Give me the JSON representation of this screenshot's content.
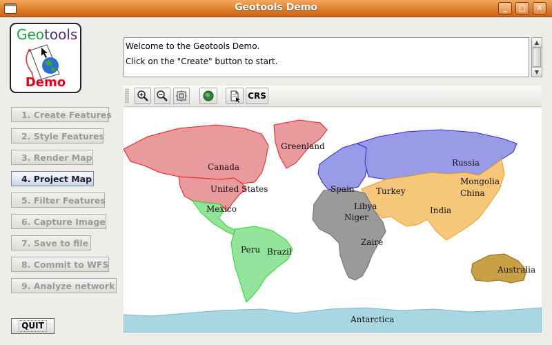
{
  "window": {
    "title": "Geotools Demo",
    "minimize": "_",
    "maximize": "□",
    "close": "✕"
  },
  "logo": {
    "title_geo": "Geo",
    "title_tools": "tools",
    "subtitle": "Demo"
  },
  "sidebar": {
    "buttons": [
      {
        "label": "1. Create Features",
        "active": false
      },
      {
        "label": "2. Style Features",
        "active": false
      },
      {
        "label": "3. Render Map",
        "active": false
      },
      {
        "label": "4. Project Map",
        "active": true
      },
      {
        "label": "5. Filter Features",
        "active": false
      },
      {
        "label": "6. Capture Image",
        "active": false
      },
      {
        "label": "7. Save to file",
        "active": false
      },
      {
        "label": "8. Commit to WFS",
        "active": false
      },
      {
        "label": "9. Analyze network",
        "active": false
      }
    ],
    "quit_label": "QUIT"
  },
  "message": {
    "line1": "Welcome to the Geotools Demo.",
    "line2": "Click on the \"Create\" button to start."
  },
  "toolbar": {
    "icons": [
      "zoom-in-icon",
      "zoom-out-icon",
      "zoom-extent-icon",
      "globe-icon",
      "info-icon"
    ],
    "crs_label": "CRS"
  },
  "map": {
    "labels": {
      "greenland": "Greenland",
      "canada": "Canada",
      "united_states": "United States",
      "mexico": "Mexico",
      "peru": "Peru",
      "brazil": "Brazil",
      "russia": "Russia",
      "spain": "Spain",
      "turkey": "Turkey",
      "mongolia": "Mongolia",
      "china": "China",
      "india": "India",
      "libya": "Libya",
      "niger": "Niger",
      "zaire": "Zaire",
      "australia": "Australia",
      "antarctica": "Antarctica"
    },
    "colors": {
      "north_america": "#e89a9c",
      "south_america": "#93e39a",
      "europe": "#9a9be6",
      "asia": "#f6c77a",
      "africa": "#9a9a9a",
      "oceania": "#c9a046",
      "antarctica": "#a8d6e2"
    }
  }
}
